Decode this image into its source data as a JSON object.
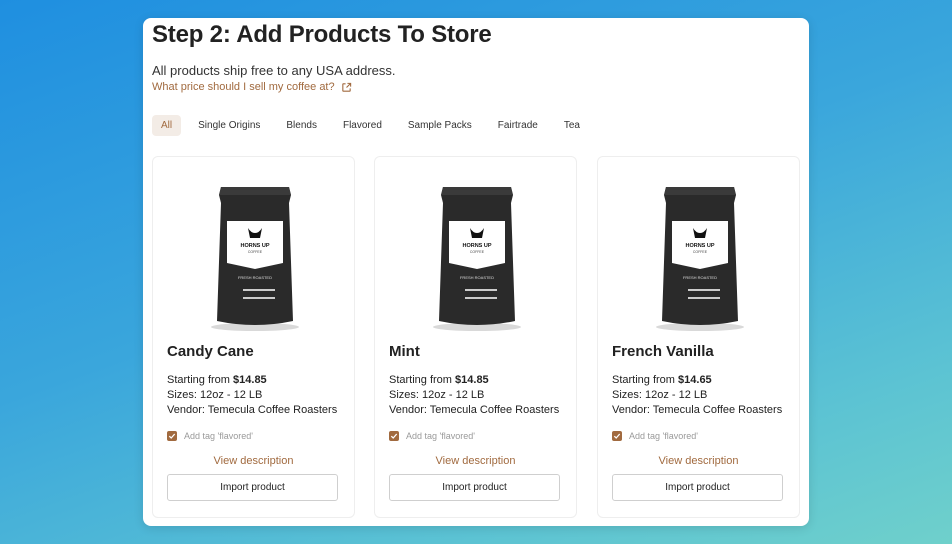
{
  "page": {
    "title": "Step 2: Add Products To Store",
    "subtitle": "All products ship free to any USA address.",
    "price_link": "What price should I sell my coffee at?"
  },
  "tabs": [
    {
      "label": "All",
      "active": true
    },
    {
      "label": "Single Origins"
    },
    {
      "label": "Blends"
    },
    {
      "label": "Flavored"
    },
    {
      "label": "Sample Packs"
    },
    {
      "label": "Fairtrade"
    },
    {
      "label": "Tea"
    }
  ],
  "colors": {
    "accent": "#a16a3f",
    "active_tab_bg": "#f3ece6"
  },
  "products": [
    {
      "name": "Candy Cane",
      "starting_label": "Starting from",
      "price": "$14.85",
      "sizes": "Sizes: 12oz - 12 LB",
      "vendor": "Vendor: Temecula Coffee Roasters",
      "tag_label": "Add tag 'flavored'",
      "view_label": "View description",
      "import_label": "Import product",
      "bag_brand": "HORNS UP",
      "bag_sub": "COFFEE",
      "bag_roast": "FRESH ROASTED"
    },
    {
      "name": "Mint",
      "starting_label": "Starting from",
      "price": "$14.85",
      "sizes": "Sizes: 12oz - 12 LB",
      "vendor": "Vendor: Temecula Coffee Roasters",
      "tag_label": "Add tag 'flavored'",
      "view_label": "View description",
      "import_label": "Import product",
      "bag_brand": "HORNS UP",
      "bag_sub": "COFFEE",
      "bag_roast": "FRESH ROASTED"
    },
    {
      "name": "French Vanilla",
      "starting_label": "Starting from",
      "price": "$14.65",
      "sizes": "Sizes: 12oz - 12 LB",
      "vendor": "Vendor: Temecula Coffee Roasters",
      "tag_label": "Add tag 'flavored'",
      "view_label": "View description",
      "import_label": "Import product",
      "bag_brand": "HORNS UP",
      "bag_sub": "COFFEE",
      "bag_roast": "FRESH ROASTED"
    }
  ]
}
